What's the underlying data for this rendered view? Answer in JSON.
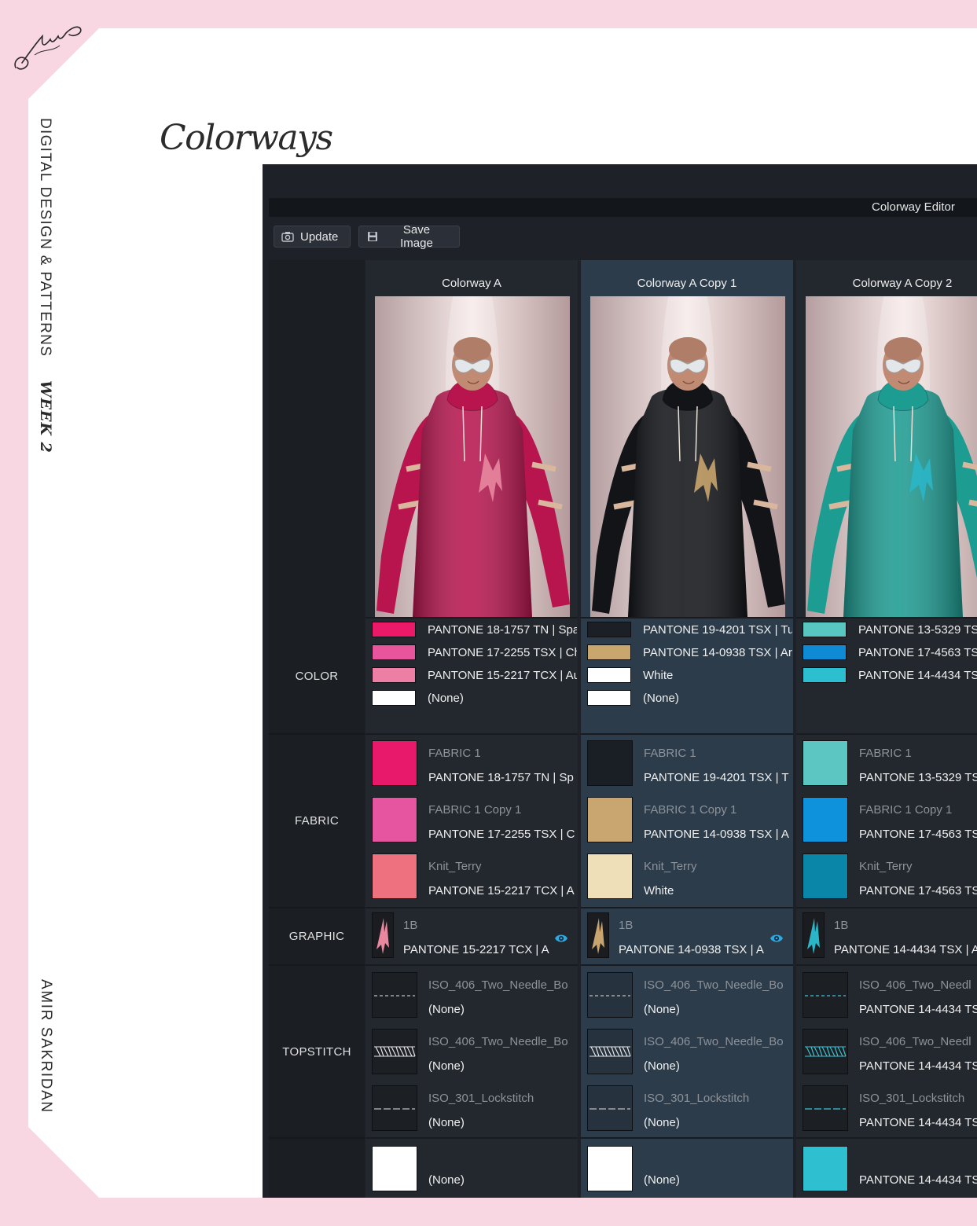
{
  "brand": {
    "logo": "Nymphea"
  },
  "page": {
    "title": "Colorways",
    "side_heading": "DIGITAL DESIGN & PATTERNS",
    "week": "WEEK 2",
    "author": "AMIR SAKRIDAN"
  },
  "app": {
    "window_title": "Colorway Editor",
    "toolbar": {
      "update_label": "Update",
      "save_label": "Save Image"
    },
    "row_labels": {
      "color": "COLOR",
      "fabric": "FABRIC",
      "graphic": "GRAPHIC",
      "topstitch": "TOPSTITCH"
    },
    "colorways": [
      {
        "name": "Colorway A",
        "garment_color": "#b8154f",
        "graphic_color": "#e8879e",
        "colors": [
          {
            "swatch": "#ea1a68",
            "label": "PANTONE 18-1757 TN | Spa"
          },
          {
            "swatch": "#e8559d",
            "label": "PANTONE 17-2255 TSX | Ch"
          },
          {
            "swatch": "#ed7fa4",
            "label": "PANTONE 15-2217 TCX | Au"
          },
          {
            "swatch": "#ffffff",
            "label": "(None)"
          }
        ],
        "fabrics": [
          {
            "swatch": "#e8186a",
            "name": "FABRIC 1",
            "value": "PANTONE 18-1757 TN | Sp"
          },
          {
            "swatch": "#e656a0",
            "name": "FABRIC 1 Copy 1",
            "value": "PANTONE 17-2255 TSX | C"
          },
          {
            "swatch": "#ee717f",
            "name": "Knit_Terry",
            "value": "PANTONE 15-2217 TCX | A"
          }
        ],
        "graphic": {
          "name": "1B",
          "value": "PANTONE 15-2217 TCX | A"
        },
        "topstitch": [
          {
            "name": "ISO_406_Two_Needle_Bo",
            "value": "(None)",
            "stitch_color": "#bfbfbf"
          },
          {
            "name": "ISO_406_Two_Needle_Bo",
            "value": "(None)",
            "stitch_color": "#e6e6e6"
          },
          {
            "name": "ISO_301_Lockstitch",
            "value": "(None)",
            "stitch_color": "#bfbfbf"
          }
        ],
        "extra": {
          "swatch": "#ffffff",
          "value": "(None)"
        }
      },
      {
        "name": "Colorway A Copy 1",
        "garment_color": "#121418",
        "graphic_color": "#c9a46e",
        "colors": [
          {
            "swatch": "#1c2026",
            "label": "PANTONE 19-4201 TSX | Tu"
          },
          {
            "swatch": "#c9a66e",
            "label": "PANTONE 14-0938 TSX | Ar"
          },
          {
            "swatch": "#ffffff",
            "label": "White"
          },
          {
            "swatch": "#ffffff",
            "label": "(None)"
          }
        ],
        "fabrics": [
          {
            "swatch": "#1a1e25",
            "name": "FABRIC 1",
            "value": "PANTONE 19-4201 TSX | T"
          },
          {
            "swatch": "#c9a670",
            "name": "FABRIC 1 Copy 1",
            "value": "PANTONE 14-0938 TSX | A"
          },
          {
            "swatch": "#efdfb8",
            "name": "Knit_Terry",
            "value": "White"
          }
        ],
        "graphic": {
          "name": "1B",
          "value": "PANTONE 14-0938 TSX | A"
        },
        "topstitch": [
          {
            "name": "ISO_406_Two_Needle_Bo",
            "value": "(None)",
            "stitch_color": "#bfbfbf"
          },
          {
            "name": "ISO_406_Two_Needle_Bo",
            "value": "(None)",
            "stitch_color": "#e6e6e6"
          },
          {
            "name": "ISO_301_Lockstitch",
            "value": "(None)",
            "stitch_color": "#bfbfbf"
          }
        ],
        "extra": {
          "swatch": "#ffffff",
          "value": "(None)"
        }
      },
      {
        "name": "Colorway A Copy 2",
        "garment_color": "#1d9c92",
        "graphic_color": "#2bb6c8",
        "colors": [
          {
            "swatch": "#58c7c2",
            "label": "PANTONE 13-5329 TS"
          },
          {
            "swatch": "#0f8bd6",
            "label": "PANTONE 17-4563 TS"
          },
          {
            "swatch": "#2bbfd0",
            "label": "PANTONE 14-4434 TS"
          }
        ],
        "fabrics": [
          {
            "swatch": "#5cc6c3",
            "name": "FABRIC 1",
            "value": "PANTONE 13-5329 TS"
          },
          {
            "swatch": "#0e92dc",
            "name": "FABRIC 1 Copy 1",
            "value": "PANTONE 17-4563 TS"
          },
          {
            "swatch": "#0a86a8",
            "name": "Knit_Terry",
            "value": "PANTONE 17-4563 TS"
          }
        ],
        "graphic": {
          "name": "1B",
          "value": "PANTONE 14-4434 TSX | A"
        },
        "topstitch": [
          {
            "name": "ISO_406_Two_Needl",
            "value": "PANTONE 14-4434 TS",
            "stitch_color": "#3cc3d4"
          },
          {
            "name": "ISO_406_Two_Needl",
            "value": "PANTONE 14-4434 TS",
            "stitch_color": "#3cc3d4"
          },
          {
            "name": "ISO_301_Lockstitch",
            "value": "PANTONE 14-4434 TS",
            "stitch_color": "#3cc3d4"
          }
        ],
        "extra": {
          "swatch": "#2ebfd0",
          "value": "PANTONE 14-4434 TS"
        }
      }
    ]
  },
  "colors": {
    "background_pink": "#f8d6e2",
    "app_bg": "#1e2228",
    "selected_column": "#2c3c4b",
    "eye_icon": "#2ea8e0"
  }
}
